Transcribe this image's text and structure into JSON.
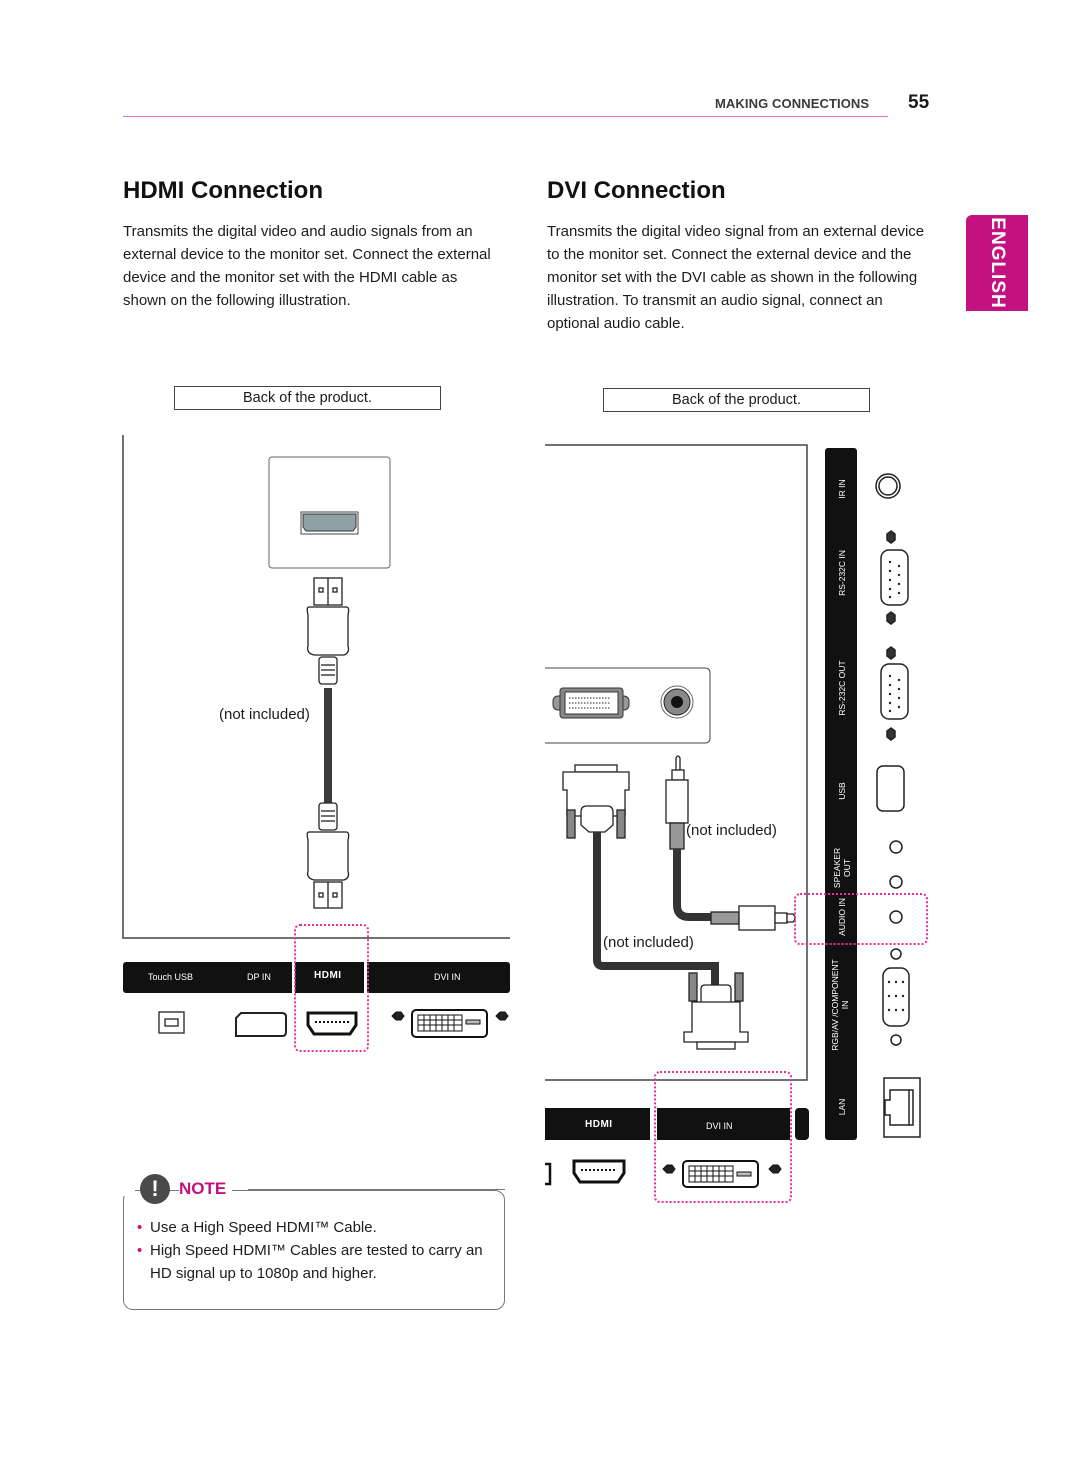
{
  "header": {
    "section": "MAKING CONNECTIONS",
    "page_number": "55"
  },
  "language_tab": "ENGLISH",
  "hdmi": {
    "title": "HDMI Connection",
    "description": "Transmits the digital video and audio signals from an external device to the monitor set. Connect the external device and the monitor set with the HDMI cable as shown on the following illustration.",
    "caption": "Back of the product.",
    "port_label": "HDMI",
    "cable_note": "(not included)",
    "strip_labels": [
      "Touch USB",
      "DP IN",
      "HDMI",
      "DVI IN"
    ]
  },
  "dvi": {
    "title": "DVI Connection",
    "description": "Transmits the digital video signal from an external device to the monitor set. Connect the external device and the monitor set with the DVI cable as shown in the following illustration. To transmit an audio signal, connect an optional audio cable.",
    "caption": "Back of the product.",
    "audio_cable_note": "(not included)",
    "dvi_cable_note": "(not included)",
    "strip_labels": [
      "HDMI",
      "DVI IN"
    ],
    "side_panel_labels": [
      "IR IN",
      "RS-232C IN",
      "RS-232C OUT",
      "USB",
      "SPEAKER OUT",
      "AUDIO IN",
      "RGB/AV /COMPONENT IN",
      "LAN"
    ]
  },
  "note": {
    "label": "NOTE",
    "items": [
      "Use a High Speed HDMI™ Cable.",
      "High Speed HDMI™ Cables are tested to carry an HD signal up to 1080p and higher."
    ]
  },
  "colors": {
    "accent": "#c3117f",
    "highlight_dotted": "#e0309a",
    "port_strip": "#111111"
  }
}
